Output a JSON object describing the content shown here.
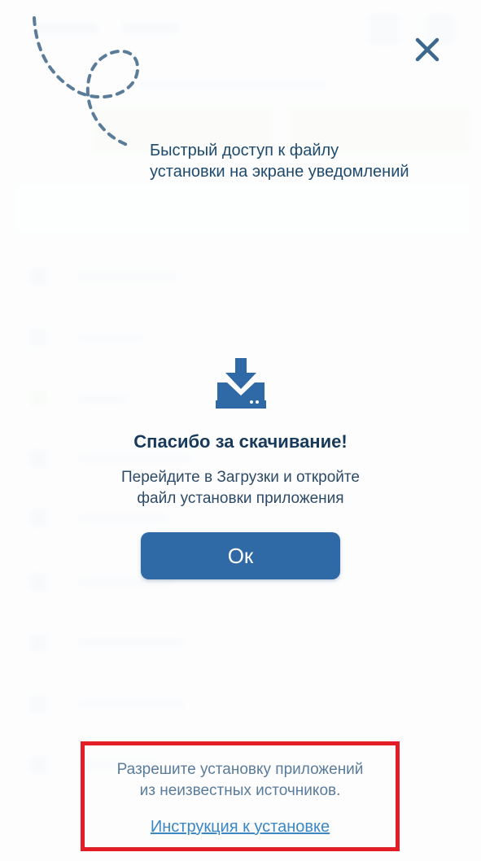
{
  "hint": {
    "line1": "Быстрый доступ к файлу",
    "line2": "установки на экране уведомлений"
  },
  "dialog": {
    "title": "Спасибо за скачивание!",
    "message_line1": "Перейдите в Загрузки и откройте",
    "message_line2": "файл установки приложения",
    "ok_label": "Ок"
  },
  "notice": {
    "line1": "Разрешите установку приложений",
    "line2": "из неизвестных источников.",
    "link_label": "Инструкция к установке"
  },
  "icons": {
    "close": "close-icon",
    "download": "download-icon",
    "decoration": "dashed-arrow-icon"
  },
  "colors": {
    "primary": "#2f6aa6",
    "title": "#173a5a",
    "highlight_border": "#e41e26",
    "link": "#3b87c6"
  }
}
